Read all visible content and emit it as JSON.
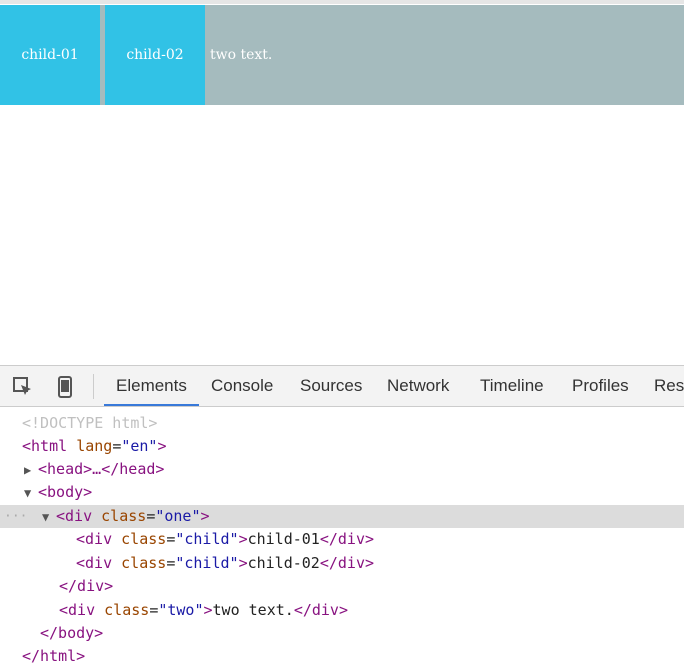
{
  "page": {
    "child_01": "child-01",
    "child_02": "child-02",
    "two_text": "two text."
  },
  "devtools": {
    "tabs": [
      "Elements",
      "Console",
      "Sources",
      "Network",
      "Timeline",
      "Profiles",
      "Reso"
    ],
    "active_tab": "Elements",
    "icons": [
      "inspect-element-icon",
      "device-mode-icon"
    ],
    "dom_lines": [
      "<!DOCTYPE html>",
      "<html lang=\"en\">",
      "▶<head>…</head>",
      "▼<body>",
      "▼<div class=\"one\">",
      "<div class=\"child\">child-01</div>",
      "<div class=\"child\">child-02</div>",
      "</div>",
      "<div class=\"two\">two text.</div>",
      "</body>",
      "</html>"
    ],
    "tokens": {
      "doctype": "<!DOCTYPE html>",
      "html_open": "<html",
      "lang_attr": "lang",
      "lang_val": "\"en\"",
      "close_angle": ">",
      "head_collapsed": "<head>…</head>",
      "body_open": "<body>",
      "div_open": "<div",
      "class_attr": "class",
      "equals": "=",
      "val_one": "\"one\"",
      "val_child": "\"child\"",
      "val_two": "\"two\"",
      "child01_text": "child-01",
      "child02_text": "child-02",
      "div_close": "</div>",
      "two_text": "two text.",
      "body_close": "</body>",
      "html_close": "</html>",
      "ellipsis": "···",
      "tri_right": "▶",
      "tri_down": "▼"
    },
    "colors": {
      "tag": "#881280",
      "attribute": "#994500",
      "value": "#1a1aa6",
      "selection": "#dcdcdc",
      "active_tab_underline": "#3879d9"
    }
  },
  "colors": {
    "child_bg": "#31c2e6",
    "one_bg": "#a5bbbe"
  }
}
